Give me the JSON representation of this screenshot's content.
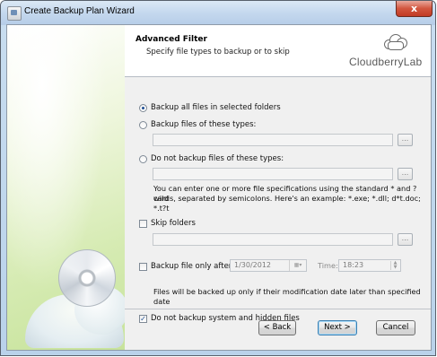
{
  "window": {
    "title": "Create Backup Plan Wizard",
    "close_label": "x"
  },
  "header": {
    "title": "Advanced Filter",
    "subtitle": "Specify file types to backup or to skip",
    "logo_text": "CloudberryLab"
  },
  "filter": {
    "option_all": "Backup all files in selected folders",
    "option_types": "Backup files of these types:",
    "option_exclude": "Do not backup files of these types:",
    "hint_line1": "You can enter one or more file specifications using the standard * and ? wild",
    "hint_line2": "cards, separated by semicolons. Here's an example: *.exe; *.dll; d*t.doc; *.t?t",
    "browse_label": "...",
    "selected": "all"
  },
  "skip": {
    "label": "Skip folders",
    "checked": false,
    "browse_label": "..."
  },
  "after": {
    "label": "Backup file only after:",
    "checked": false,
    "date_value": "1/30/2012",
    "time_label": "Time:",
    "time_value": "18:23",
    "note": "Files will be backed up only if their modification date later than specified date"
  },
  "system": {
    "label": "Do not backup system and hidden files",
    "checked": true
  },
  "buttons": {
    "back": "< Back",
    "next": "Next >",
    "cancel": "Cancel"
  }
}
